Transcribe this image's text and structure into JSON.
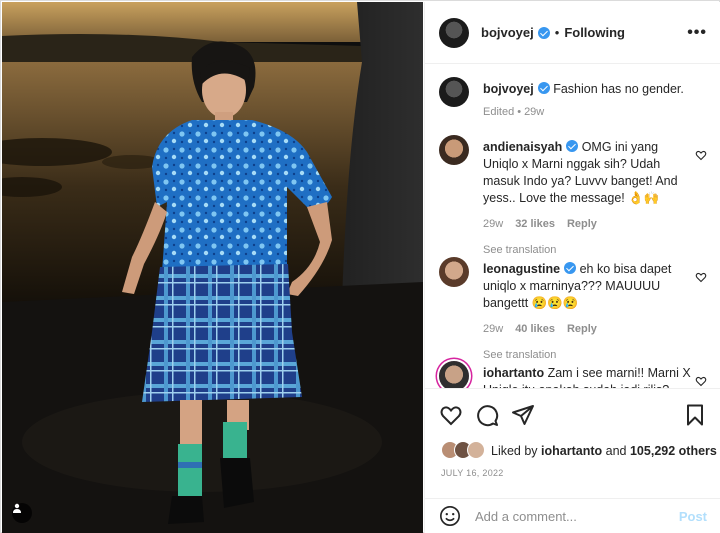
{
  "post_header": {
    "username": "bojvoyej",
    "separator": "•",
    "follow_status": "Following",
    "more_label": "•••"
  },
  "caption": {
    "username": "bojvoyej",
    "text": "Fashion has no gender.",
    "edited": "Edited",
    "separator": "•",
    "age": "29w"
  },
  "comments": [
    {
      "username": "andienaisyah",
      "text": "OMG ini yang Uniqlo x Marni nggak sih? Udah masuk Indo ya? Luvvv banget! And yess.. Love the message! 👌🙌",
      "age": "29w",
      "likes": "32 likes",
      "reply": "Reply",
      "see_translation": "See translation"
    },
    {
      "username": "leonagustine",
      "text": "eh ko bisa dapet uniqlo x marninya??? MAUUUU bangettt 😢😢😢",
      "age": "29w",
      "likes": "40 likes",
      "reply": "Reply",
      "see_translation": "See translation"
    },
    {
      "username": "iohartanto",
      "text": "Zam i see marni!! Marni X Uniqlo itu apakah sudah jadi rilis?"
    }
  ],
  "likes_summary": {
    "prefix": "Liked by",
    "user": "iohartanto",
    "middle": "and",
    "others": "105,292 others"
  },
  "post_date": "JULY 16, 2022",
  "add_comment": {
    "placeholder": "Add a comment...",
    "post_label": "Post"
  },
  "colors": {
    "verified": "#3897f0",
    "text": "#262626",
    "muted": "#8e8e8e",
    "post_disabled": "#b2dffc"
  }
}
